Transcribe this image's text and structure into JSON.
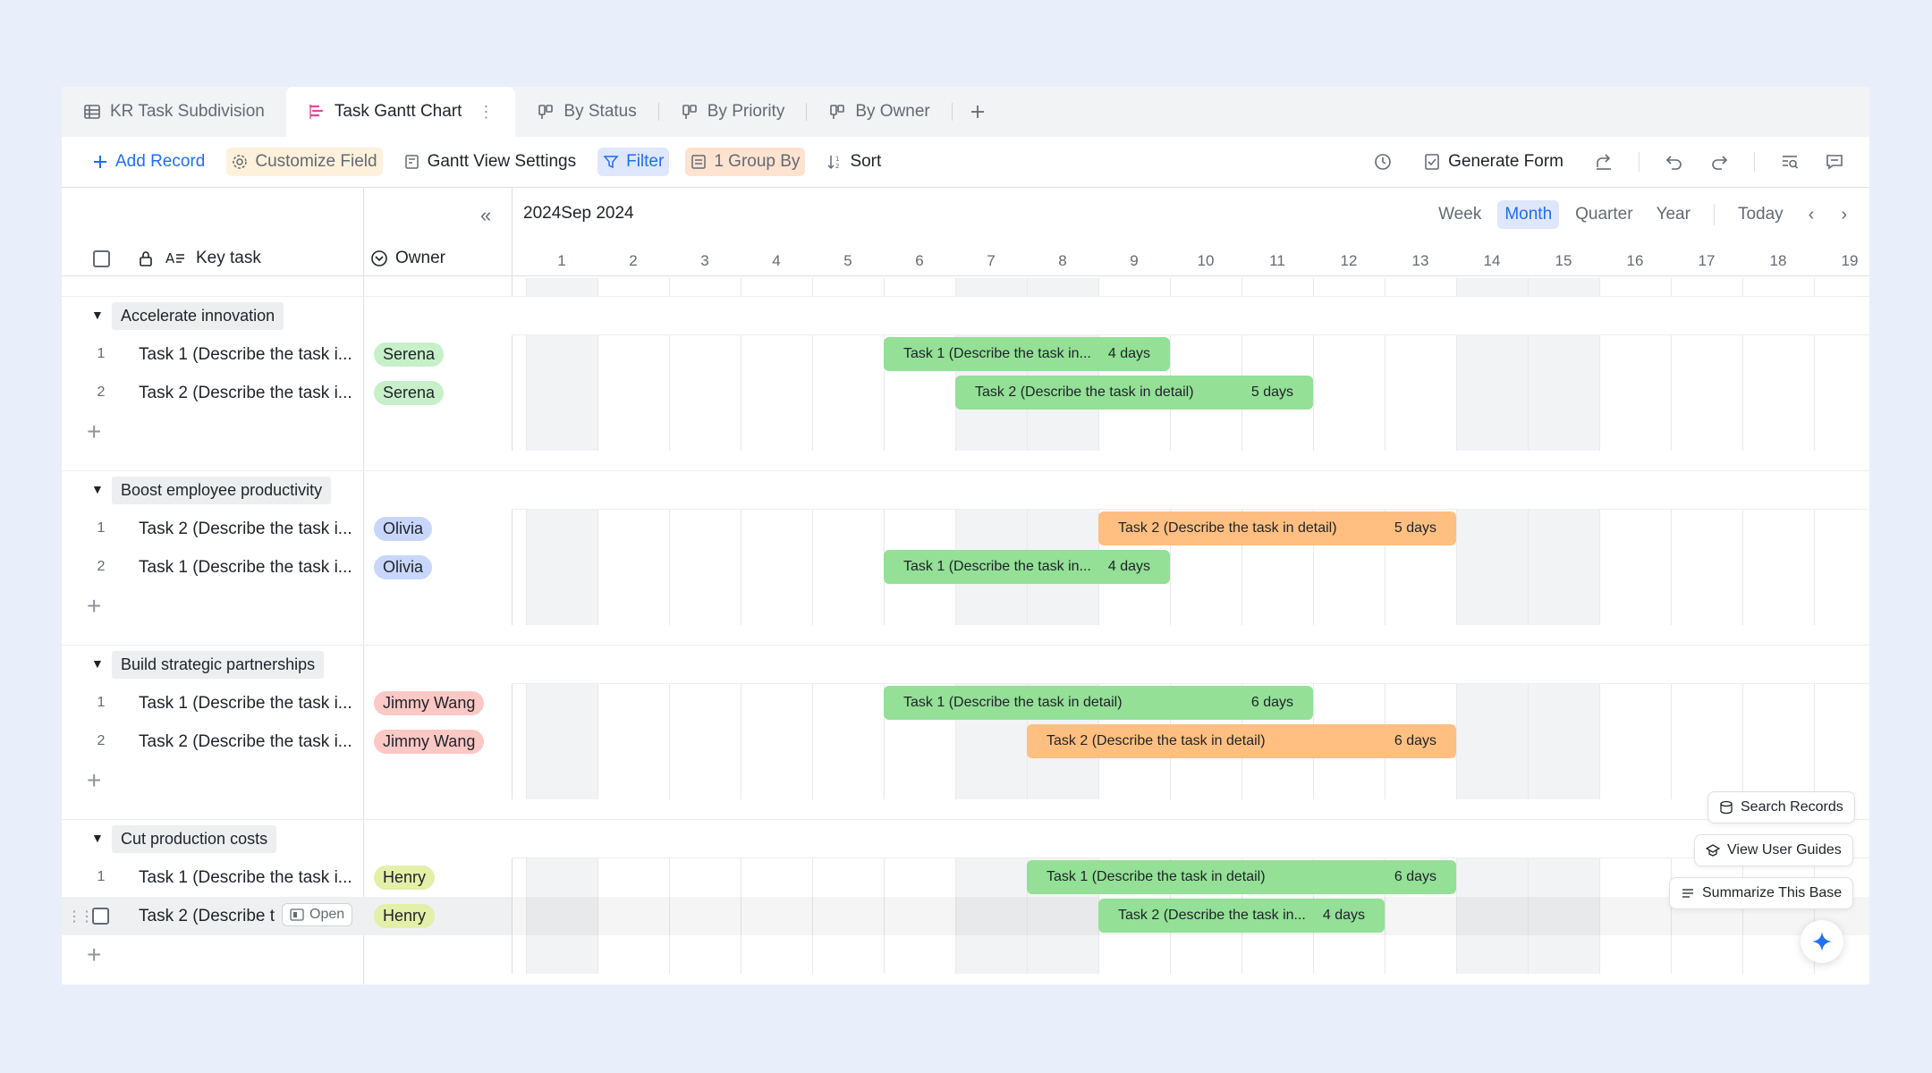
{
  "tabs": [
    {
      "label": "KR Task Subdivision",
      "icon": "table-icon"
    },
    {
      "label": "Task Gantt Chart",
      "icon": "gantt-icon",
      "active": true
    },
    {
      "label": "By Status",
      "icon": "kanban-icon"
    },
    {
      "label": "By Priority",
      "icon": "kanban-icon"
    },
    {
      "label": "By Owner",
      "icon": "kanban-icon"
    }
  ],
  "toolbar": {
    "add_record": "Add Record",
    "customize_field": "Customize Field",
    "gantt_settings": "Gantt View Settings",
    "filter": "Filter",
    "group_by": "1 Group By",
    "sort": "Sort",
    "generate_form": "Generate Form"
  },
  "header": {
    "key_task": "Key task",
    "owner": "Owner",
    "month": "2024Sep 2024",
    "scales": [
      "Week",
      "Month",
      "Quarter",
      "Year"
    ],
    "active_scale": "Month",
    "today": "Today",
    "days": [
      "1",
      "2",
      "3",
      "4",
      "5",
      "6",
      "7",
      "8",
      "9",
      "10",
      "11",
      "12",
      "13",
      "14",
      "15",
      "16",
      "17",
      "18",
      "19"
    ]
  },
  "groups": [
    {
      "name": "Accelerate innovation",
      "records": [
        {
          "num": "1",
          "title": "Task 1 (Describe the task i...",
          "owner": "Serena",
          "bar": "Task 1 (Describe the task in...",
          "days": "4 days",
          "start": 6,
          "len": 4,
          "color": "green"
        },
        {
          "num": "2",
          "title": "Task 2 (Describe the task i...",
          "owner": "Serena",
          "bar": "Task 2 (Describe the task in detail)",
          "days": "5 days",
          "start": 7,
          "len": 5,
          "color": "green"
        }
      ]
    },
    {
      "name": "Boost employee productivity",
      "records": [
        {
          "num": "1",
          "title": "Task 2 (Describe the task i...",
          "owner": "Olivia",
          "bar": "Task 2 (Describe the task in detail)",
          "days": "5 days",
          "start": 9,
          "len": 5,
          "color": "orange"
        },
        {
          "num": "2",
          "title": "Task 1 (Describe the task i...",
          "owner": "Olivia",
          "bar": "Task 1 (Describe the task in...",
          "days": "4 days",
          "start": 6,
          "len": 4,
          "color": "green"
        }
      ]
    },
    {
      "name": "Build strategic partnerships",
      "records": [
        {
          "num": "1",
          "title": "Task 1 (Describe the task i...",
          "owner": "Jimmy Wang",
          "bar": "Task 1 (Describe the task in detail)",
          "days": "6 days",
          "start": 6,
          "len": 6,
          "color": "green"
        },
        {
          "num": "2",
          "title": "Task 2 (Describe the task i...",
          "owner": "Jimmy Wang",
          "bar": "Task 2 (Describe the task in detail)",
          "days": "6 days",
          "start": 8,
          "len": 6,
          "color": "orange"
        }
      ]
    },
    {
      "name": "Cut production costs",
      "records": [
        {
          "num": "1",
          "title": "Task 1 (Describe the task i...",
          "owner": "Henry",
          "bar": "Task 1 (Describe the task in detail)",
          "days": "6 days",
          "start": 8,
          "len": 6,
          "color": "green"
        },
        {
          "num": "",
          "title": "Task 2 (Describe t",
          "owner": "Henry",
          "bar": "Task 2 (Describe the task in...",
          "days": "4 days",
          "start": 9,
          "len": 4,
          "color": "green",
          "hover": true
        }
      ]
    }
  ],
  "open_label": "Open",
  "owner_colors": {
    "Serena": "#c7f0c9",
    "Olivia": "#c9d6fb",
    "Jimmy Wang": "#fbc8c5",
    "Henry": "#e4efa8"
  },
  "floating": {
    "search_records": "Search Records",
    "view_user_guides": "View User Guides",
    "summarize": "Summarize This Base"
  },
  "weekend_days": [
    1,
    7,
    8,
    14,
    15
  ]
}
